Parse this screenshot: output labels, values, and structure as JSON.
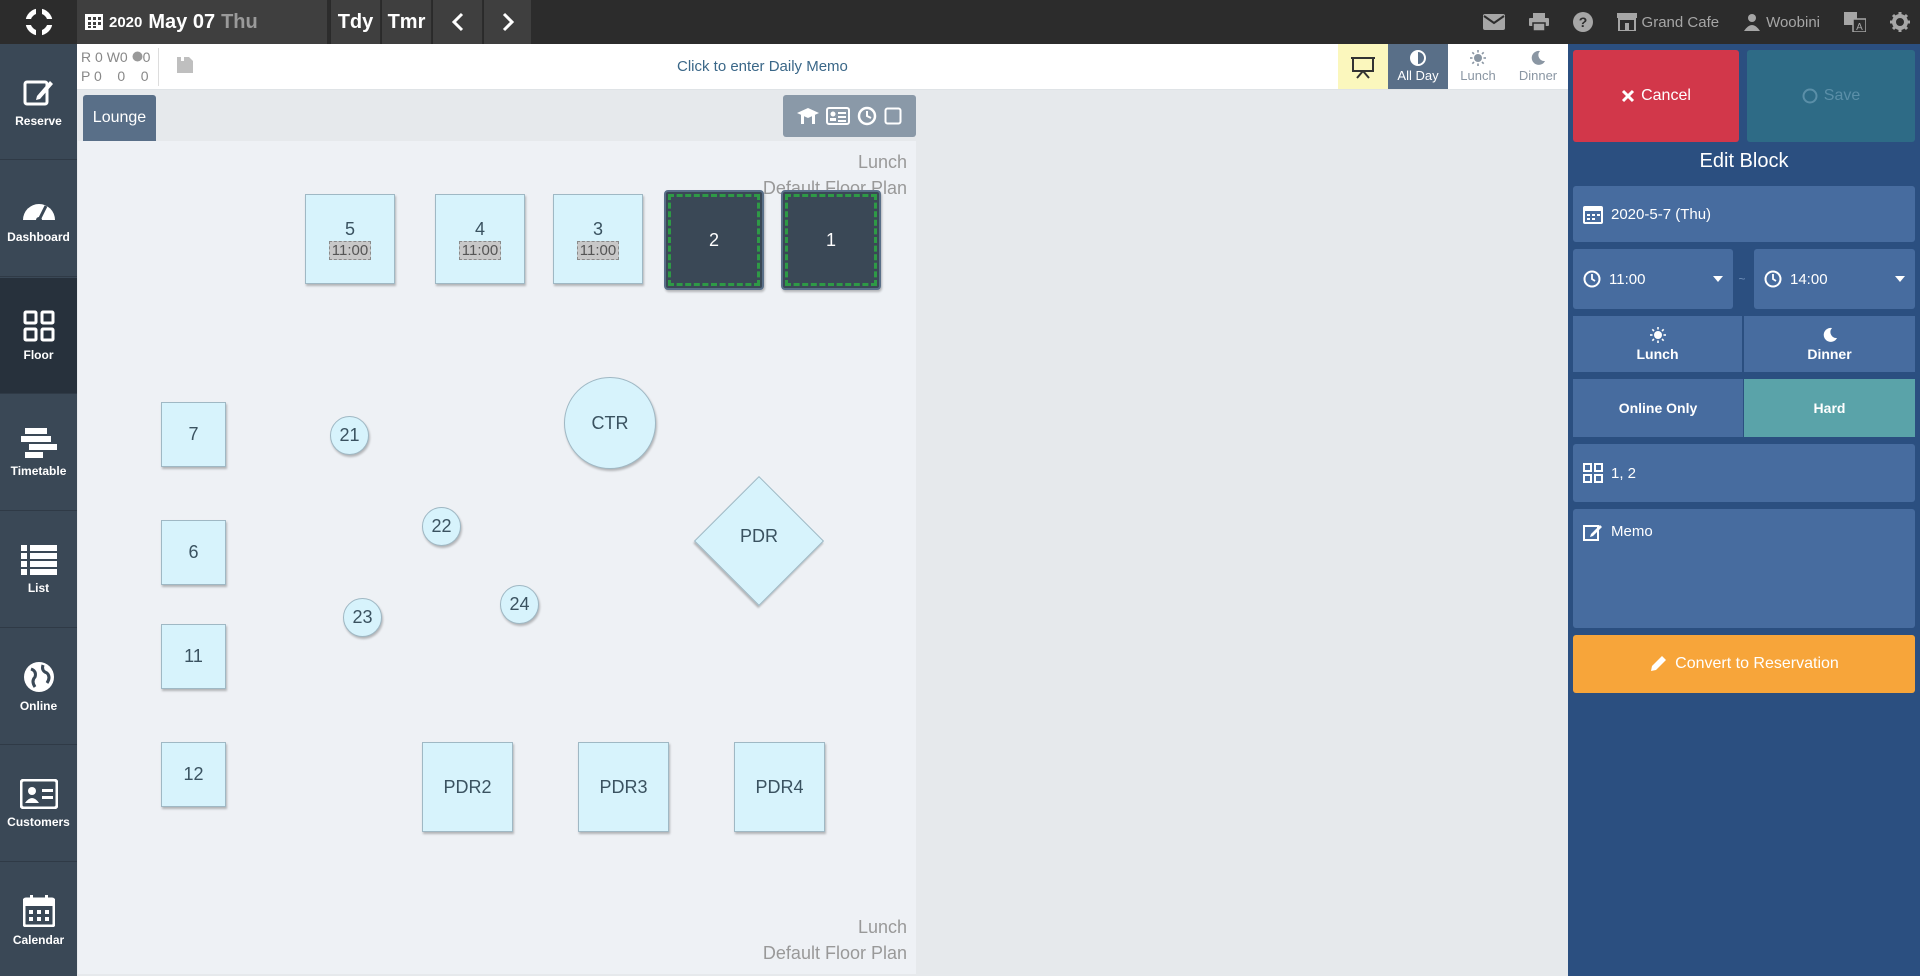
{
  "topbar": {
    "year": "2020",
    "month_day": "May 07",
    "weekday": "Thu",
    "today_label": "Tdy",
    "tomorrow_label": "Tmr",
    "restaurant": "Grand Cafe",
    "user": "Woobini"
  },
  "sidebar": {
    "items": [
      {
        "label": "Reserve",
        "icon": "edit-icon"
      },
      {
        "label": "Dashboard",
        "icon": "gauge-icon"
      },
      {
        "label": "Floor",
        "icon": "floor-grid-icon"
      },
      {
        "label": "Timetable",
        "icon": "timetable-icon"
      },
      {
        "label": "List",
        "icon": "list-icon"
      },
      {
        "label": "Online",
        "icon": "globe-icon"
      },
      {
        "label": "Customers",
        "icon": "customer-card-icon"
      },
      {
        "label": "Calendar",
        "icon": "calendar-icon"
      }
    ]
  },
  "stats": {
    "r_label": "R",
    "r1": "0",
    "w_label": "W",
    "w": "0",
    "g": "0",
    "p_label": "P",
    "p1": "0",
    "p2": "0",
    "p3": "0"
  },
  "memo": {
    "placeholder": "Click to enter Daily Memo"
  },
  "view": {
    "all_day": "All Day",
    "lunch": "Lunch",
    "dinner": "Dinner"
  },
  "floor": {
    "tab": "Lounge",
    "label_top": {
      "line1": "Lunch",
      "line2": "Default Floor Plan"
    },
    "label_bottom": {
      "line1": "Lunch",
      "line2": "Default Floor Plan"
    },
    "tables": {
      "t5": {
        "name": "5",
        "time": "11:00"
      },
      "t4": {
        "name": "4",
        "time": "11:00"
      },
      "t3": {
        "name": "3",
        "time": "11:00"
      },
      "t2": {
        "name": "2"
      },
      "t1": {
        "name": "1"
      },
      "t7": {
        "name": "7"
      },
      "t6": {
        "name": "6"
      },
      "t11": {
        "name": "11"
      },
      "t12": {
        "name": "12"
      },
      "t21": {
        "name": "21"
      },
      "t22": {
        "name": "22"
      },
      "t23": {
        "name": "23"
      },
      "t24": {
        "name": "24"
      },
      "ctr": {
        "name": "CTR"
      },
      "pdr": {
        "name": "PDR"
      },
      "pdr2": {
        "name": "PDR2"
      },
      "pdr3": {
        "name": "PDR3"
      },
      "pdr4": {
        "name": "PDR4"
      }
    }
  },
  "panel": {
    "cancel": "Cancel",
    "save": "Save",
    "title": "Edit Block",
    "date": "2020-5-7 (Thu)",
    "start_time": "11:00",
    "end_time": "14:00",
    "separator": "~",
    "lunch": "Lunch",
    "dinner": "Dinner",
    "online_only": "Online Only",
    "hard": "Hard",
    "tables": "1, 2",
    "memo_placeholder": "Memo",
    "convert": "Convert to Reservation"
  },
  "colors": {
    "cancel": "#d2374a",
    "save": "#2e6b86",
    "hard": "#5aa3a9",
    "convert": "#f7a53a",
    "panel": "#2b4f80"
  }
}
